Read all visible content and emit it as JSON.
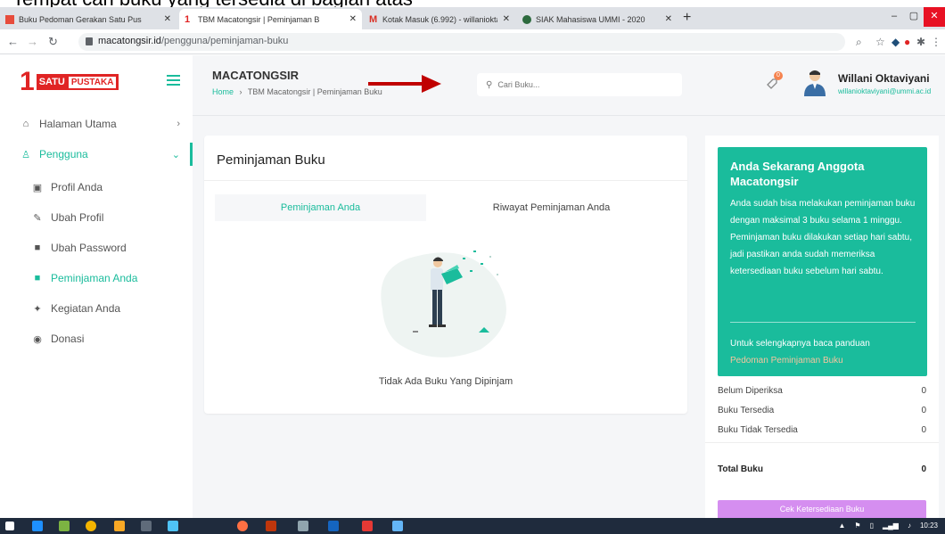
{
  "caption": "Tempat cari buku yang tersedia di bagian atas",
  "browser": {
    "tabs": [
      {
        "title": "Buku Pedoman Gerakan Satu Pus",
        "active": false
      },
      {
        "title": "TBM Macatongsir | Peminjaman B",
        "active": true
      },
      {
        "title": "Kotak Masuk (6.992) - willanioktav",
        "active": false
      },
      {
        "title": "SIAK Mahasiswa UMMI - 2020",
        "active": false
      }
    ],
    "url_domain": "macatongsir.id",
    "url_path": "/pengguna/peminjaman-buku"
  },
  "brand": {
    "one": "1",
    "satu": "SATU",
    "pustaka": "PUSTAKA"
  },
  "sidebar": {
    "items": [
      {
        "label": "Halaman Utama",
        "icon": "home-icon"
      },
      {
        "label": "Pengguna",
        "icon": "user-icon"
      },
      {
        "label": "Profil Anda",
        "icon": "id-card-icon"
      },
      {
        "label": "Ubah Profil",
        "icon": "edit-icon"
      },
      {
        "label": "Ubah Password",
        "icon": "lock-icon"
      },
      {
        "label": "Peminjaman Anda",
        "icon": "book-icon"
      },
      {
        "label": "Kegiatan Anda",
        "icon": "running-icon"
      },
      {
        "label": "Donasi",
        "icon": "coin-icon"
      }
    ]
  },
  "header": {
    "title": "MACATONGSIR",
    "breadcrumb_home": "Home",
    "breadcrumb_sep": "›",
    "breadcrumb_current": "TBM Macatongsir | Peminjaman Buku",
    "search_placeholder": "Cari Buku...",
    "notif_count": "0",
    "user_name": "Willani Oktaviyani",
    "user_email": "willanioktaviyani@ummi.ac.id"
  },
  "main": {
    "title": "Peminjaman Buku",
    "tabs": [
      "Peminjaman Anda",
      "Riwayat Peminjaman Anda"
    ],
    "empty_text": "Tidak Ada Buku Yang Dipinjam"
  },
  "panel": {
    "info_title": "Anda Sekarang Anggota Macatongsir",
    "info_body": "Anda sudah bisa melakukan peminjaman buku dengan maksimal 3 buku selama 1 minggu. Peminjaman buku dilakukan setiap hari sabtu, jadi pastikan anda sudah memeriksa ketersediaan buku sebelum hari sabtu.",
    "info_more": "Untuk selengkapnya baca panduan",
    "info_link": "Pedoman Peminjaman Buku",
    "stats": [
      {
        "label": "Belum Diperiksa",
        "value": "0"
      },
      {
        "label": "Buku Tersedia",
        "value": "0"
      },
      {
        "label": "Buku Tidak Tersedia",
        "value": "0"
      }
    ],
    "total_label": "Total Buku",
    "total_value": "0",
    "button_label": "Cek Ketersediaan Buku"
  },
  "taskbar": {
    "time": "10:23"
  },
  "colors": {
    "accent": "#1abc9c",
    "brand_red": "#e02424",
    "arrow": "#c00000",
    "button": "#d58ef0"
  }
}
